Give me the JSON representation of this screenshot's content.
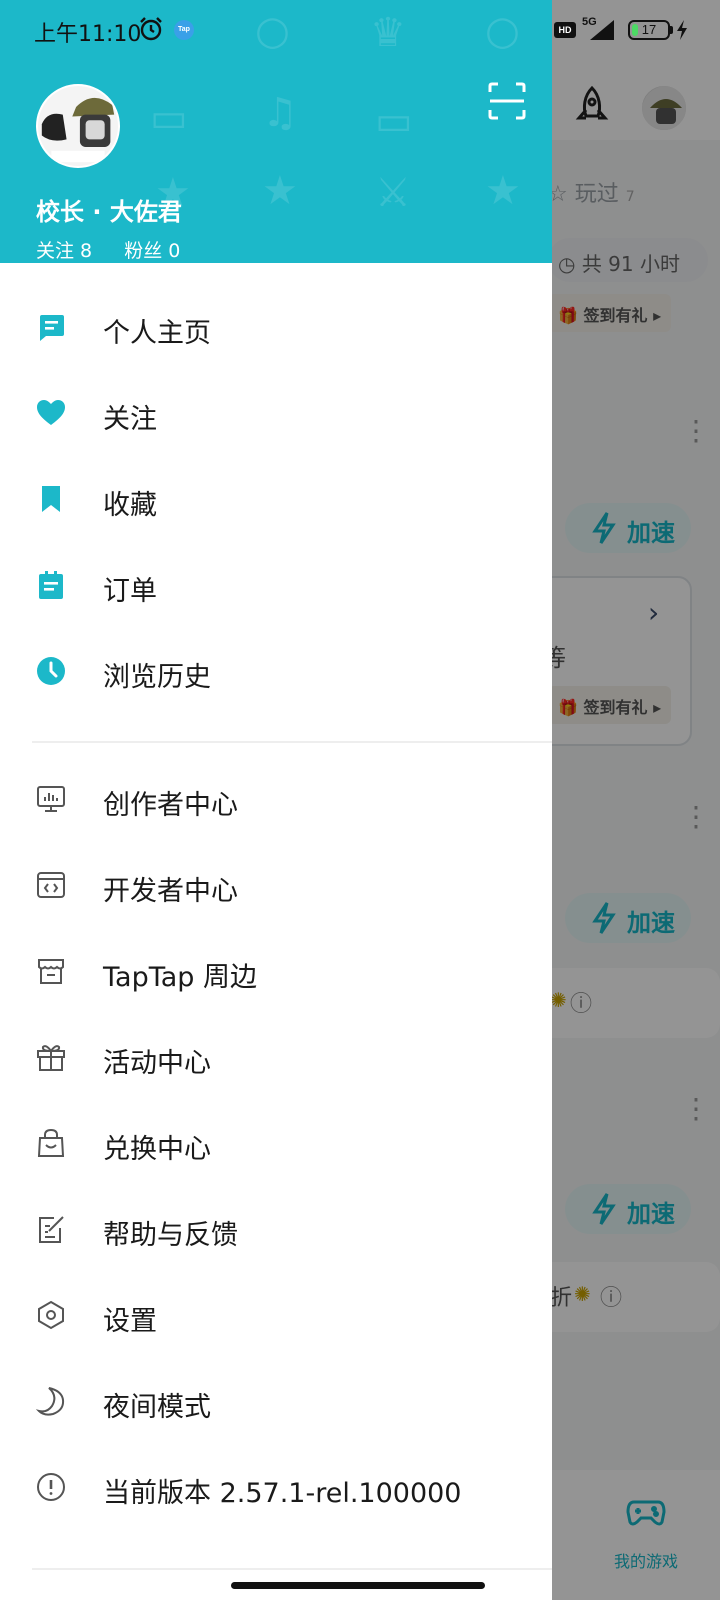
{
  "status_bar": {
    "time": "上午11:10",
    "tap_badge": "Tap",
    "hd": "HD",
    "network": "5G",
    "battery": "17",
    "battery_level": 0.17
  },
  "profile": {
    "name": "校长 · 大佐君",
    "following": "关注 8",
    "followers": "粉丝 0"
  },
  "menu_primary": [
    {
      "label": "个人主页",
      "icon": "profile-page-icon"
    },
    {
      "label": "关注",
      "icon": "heart-icon"
    },
    {
      "label": "收藏",
      "icon": "bookmark-icon"
    },
    {
      "label": "订单",
      "icon": "order-clipboard-icon"
    },
    {
      "label": "浏览历史",
      "icon": "clock-icon"
    }
  ],
  "menu_secondary": [
    {
      "label": "创作者中心",
      "icon": "creator-monitor-icon"
    },
    {
      "label": "开发者中心",
      "icon": "developer-code-icon"
    },
    {
      "label": "TapTap 周边",
      "icon": "store-icon"
    },
    {
      "label": "活动中心",
      "icon": "gift-icon"
    },
    {
      "label": "兑换中心",
      "icon": "shopping-bag-icon"
    },
    {
      "label": "帮助与反馈",
      "icon": "feedback-edit-icon"
    },
    {
      "label": "设置",
      "icon": "settings-hexagon-icon"
    },
    {
      "label": "夜间模式",
      "icon": "moon-icon"
    },
    {
      "label": "当前版本 2.57.1-rel.100000",
      "icon": "info-icon"
    }
  ],
  "background": {
    "played_label": "玩过",
    "played_count": "7",
    "hours": "共 91 小时",
    "gift_label": "签到有礼",
    "accelerate_label": "加速",
    "frag_1": "等",
    "frag_2": "折",
    "my_games": "我的游戏"
  },
  "colors": {
    "accent": "#1cb8c9"
  }
}
